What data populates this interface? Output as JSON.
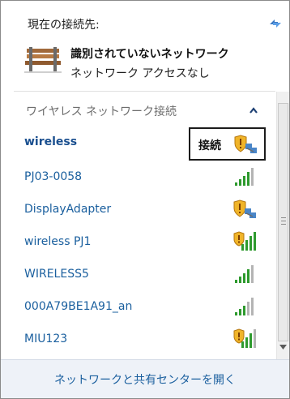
{
  "header": {
    "title": "現在の接続先:",
    "network_name": "識別されていないネットワーク",
    "network_status": "ネットワーク アクセスなし"
  },
  "section": {
    "label": "ワイヤレス ネットワーク接続"
  },
  "networks": [
    {
      "name": "wireless",
      "selected": true,
      "signal": "shield-warning-icon",
      "action_label": "接続"
    },
    {
      "name": "PJ03-0058",
      "signal": "signal-bars-4-of-5"
    },
    {
      "name": "DisplayAdapter",
      "signal": "adhoc-network-shield-icon"
    },
    {
      "name": "wireless PJ1",
      "signal": "shield-signal-5-of-5"
    },
    {
      "name": "WIRELESS5",
      "signal": "signal-bars-4-of-5"
    },
    {
      "name": "000A79BE1A91_an",
      "signal": "signal-bars-3-of-5"
    },
    {
      "name": "MIU123",
      "signal": "shield-signal-4-of-5"
    }
  ],
  "footer": {
    "link": "ネットワークと共有センターを開く"
  },
  "colors": {
    "link": "#1a5f9e",
    "signal_green": "#2e9a2e",
    "signal_gray": "#b4b4b4",
    "footer_bg": "#eef2f8"
  }
}
